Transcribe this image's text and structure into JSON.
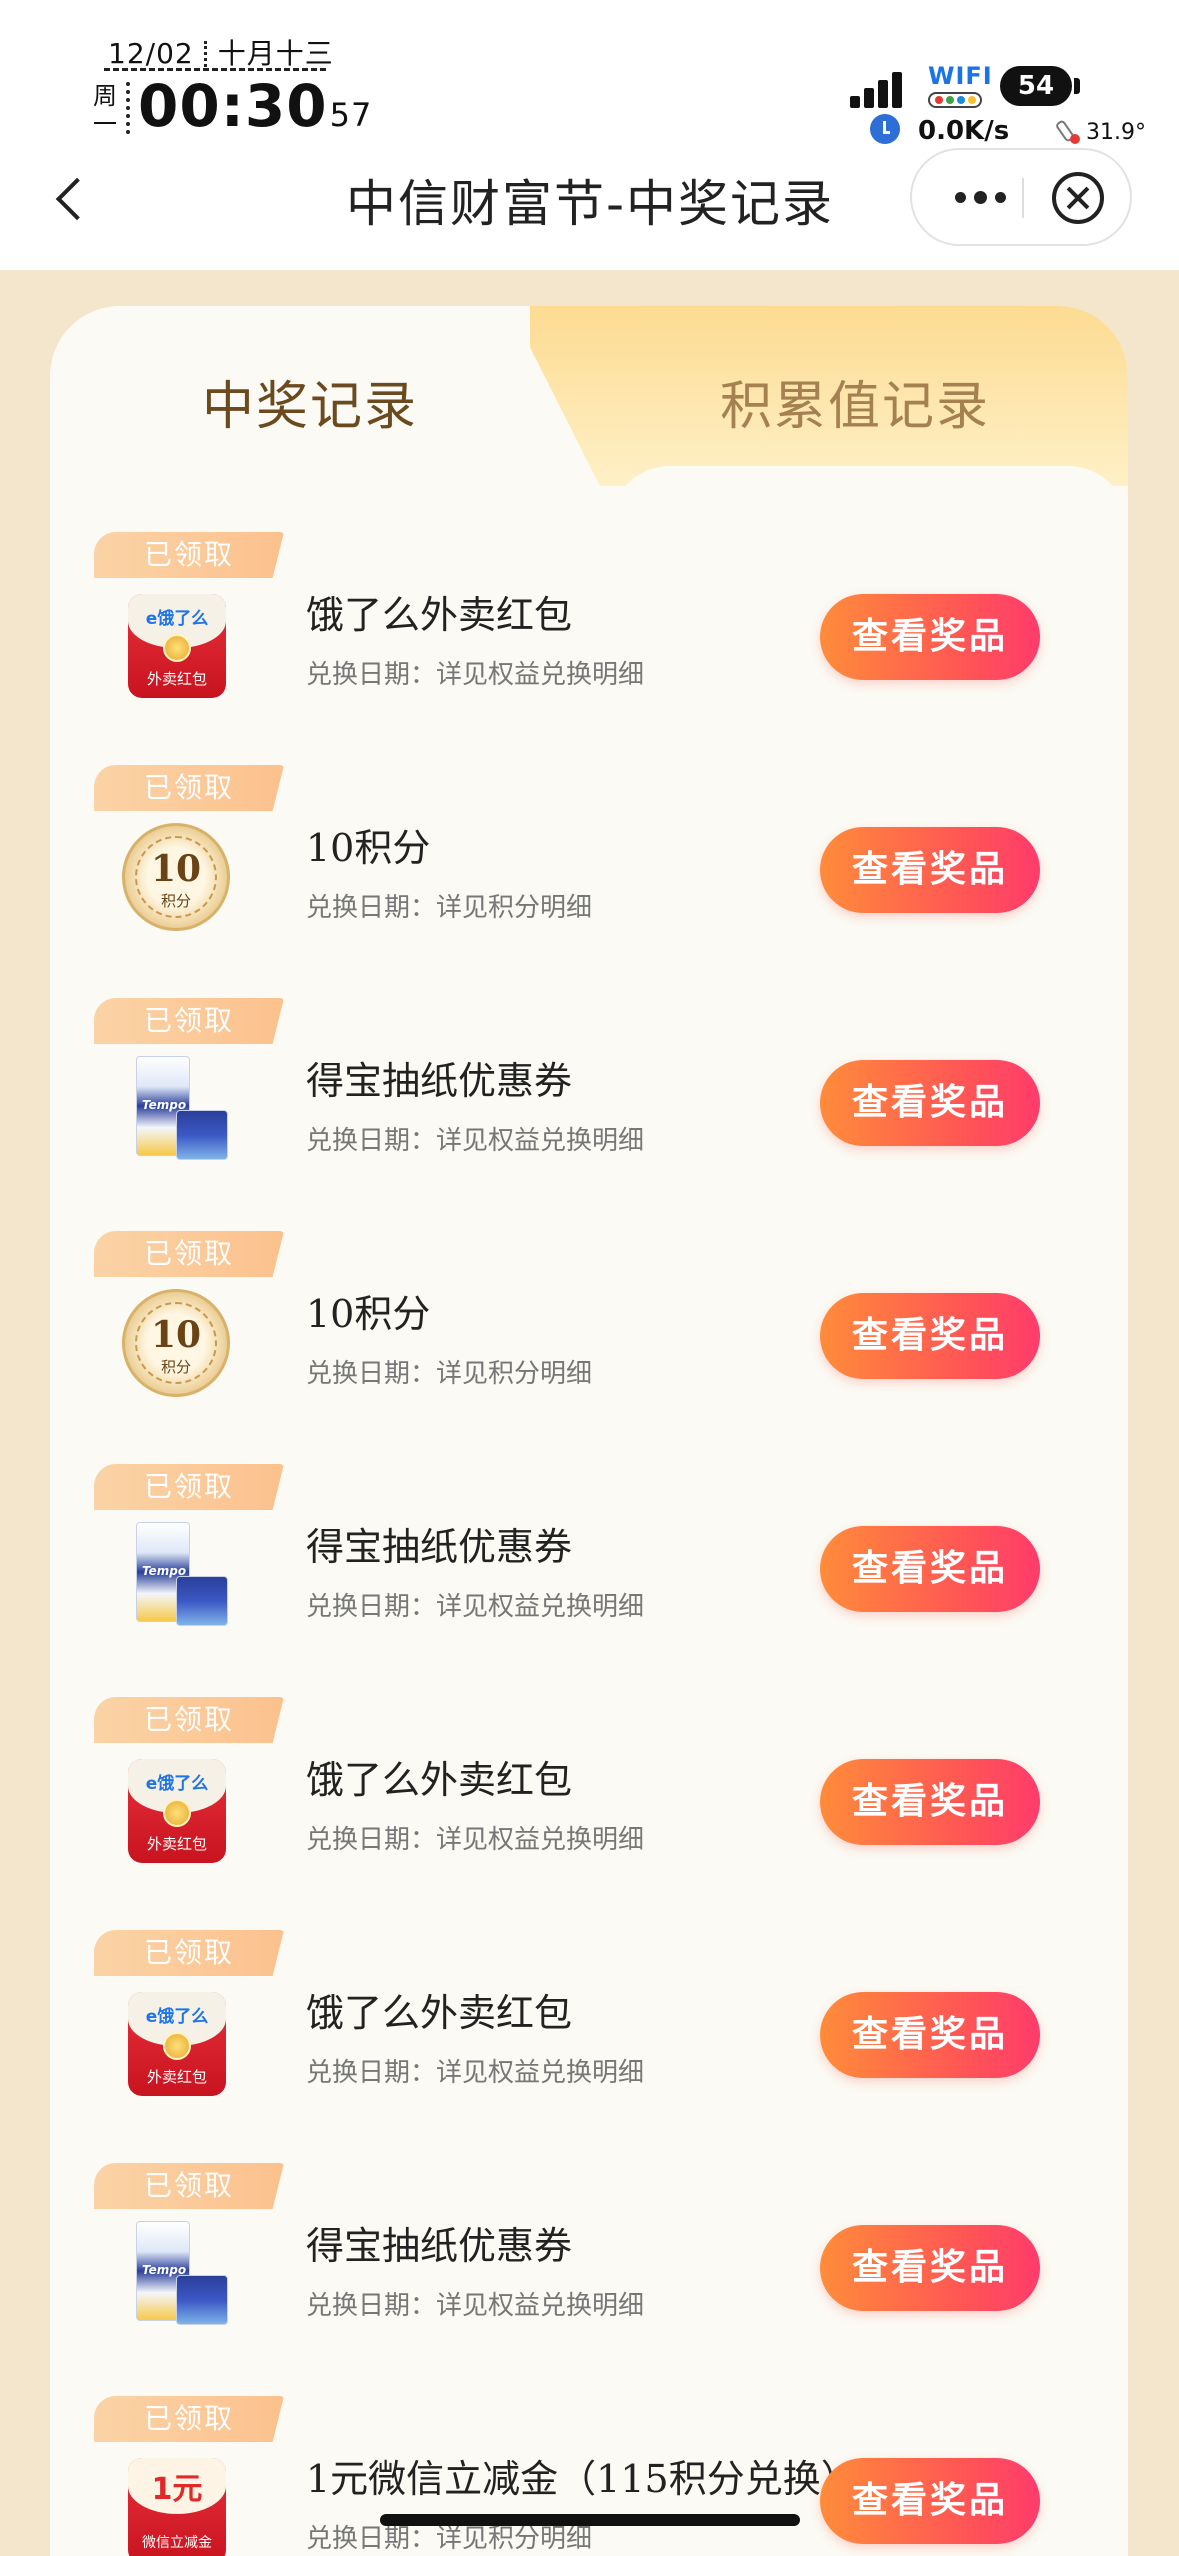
{
  "status_bar": {
    "date": "12/02",
    "lunar": "十月十三",
    "weekday": "周一",
    "time": "00:30",
    "seconds": "57",
    "wifi": "WIFI",
    "battery": "54",
    "net_speed": "0.0K/s",
    "temperature": "31.9°"
  },
  "nav": {
    "title": "中信财富节-中奖记录"
  },
  "tabs": [
    {
      "label": "中奖记录",
      "active": true
    },
    {
      "label": "积累值记录",
      "active": false
    }
  ],
  "records": [
    {
      "status": "已领取",
      "name": "饿了么外卖红包",
      "date": "兑换日期：详见权益兑换明细",
      "icon": "red-packet",
      "button": "查看奖品",
      "thumb_label": "e饿了么",
      "thumb_text": "外卖红包"
    },
    {
      "status": "已领取",
      "name": "10积分",
      "date": "兑换日期：详见积分明细",
      "icon": "points-coin",
      "button": "查看奖品",
      "thumb_label": "10",
      "thumb_text": "积分"
    },
    {
      "status": "已领取",
      "name": "得宝抽纸优惠券",
      "date": "兑换日期：详见权益兑换明细",
      "icon": "tissue",
      "button": "查看奖品",
      "thumb_label": "Tempo",
      "thumb_text": ""
    },
    {
      "status": "已领取",
      "name": "10积分",
      "date": "兑换日期：详见积分明细",
      "icon": "points-coin",
      "button": "查看奖品",
      "thumb_label": "10",
      "thumb_text": "积分"
    },
    {
      "status": "已领取",
      "name": "得宝抽纸优惠券",
      "date": "兑换日期：详见权益兑换明细",
      "icon": "tissue",
      "button": "查看奖品",
      "thumb_label": "Tempo",
      "thumb_text": ""
    },
    {
      "status": "已领取",
      "name": "饿了么外卖红包",
      "date": "兑换日期：详见权益兑换明细",
      "icon": "red-packet",
      "button": "查看奖品",
      "thumb_label": "e饿了么",
      "thumb_text": "外卖红包"
    },
    {
      "status": "已领取",
      "name": "饿了么外卖红包",
      "date": "兑换日期：详见权益兑换明细",
      "icon": "red-packet",
      "button": "查看奖品",
      "thumb_label": "e饿了么",
      "thumb_text": "外卖红包"
    },
    {
      "status": "已领取",
      "name": "得宝抽纸优惠券",
      "date": "兑换日期：详见权益兑换明细",
      "icon": "tissue",
      "button": "查看奖品",
      "thumb_label": "Tempo",
      "thumb_text": ""
    },
    {
      "status": "已领取",
      "name": "1元微信立减金（115积分兑换）",
      "date": "兑换日期：详见积分明细",
      "icon": "cash-voucher",
      "button": "查看奖品",
      "thumb_label": "1元",
      "thumb_text": "微信立减金"
    }
  ],
  "colors": {
    "page_bg": "#f3e6cc",
    "card_bg": "#fbfaf4",
    "button_start": "#ff8c3a",
    "button_end": "#ff3b6b",
    "badge": "#fcc18d",
    "tab_active_text": "#6b4a1f",
    "tab_inactive_text": "#a58152"
  }
}
